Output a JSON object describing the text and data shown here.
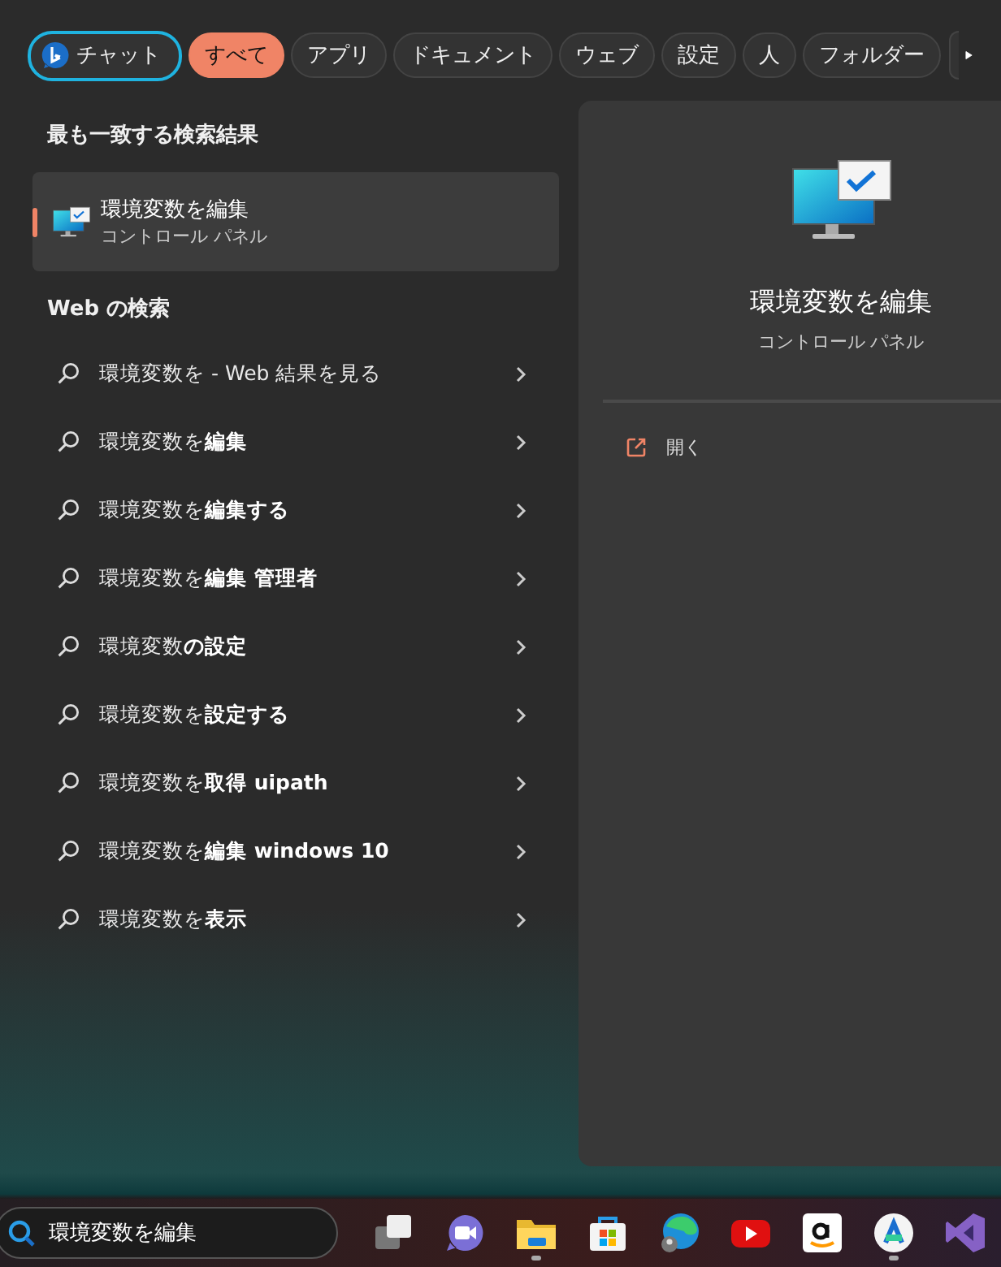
{
  "filters": [
    {
      "label": "チャット",
      "kind": "chat",
      "selected": false
    },
    {
      "label": "すべて",
      "kind": "plain",
      "selected": true
    },
    {
      "label": "アプリ",
      "kind": "plain",
      "selected": false
    },
    {
      "label": "ドキュメント",
      "kind": "plain",
      "selected": false
    },
    {
      "label": "ウェブ",
      "kind": "plain",
      "selected": false
    },
    {
      "label": "設定",
      "kind": "plain",
      "selected": false
    },
    {
      "label": "人",
      "kind": "plain",
      "selected": false
    },
    {
      "label": "フォルダー",
      "kind": "plain",
      "selected": false
    }
  ],
  "best_match": {
    "heading": "最も一致する検索結果",
    "title": "環境変数を編集",
    "subtitle": "コントロール パネル",
    "selected": true
  },
  "web": {
    "heading": "Web の検索",
    "suggestions": [
      {
        "text": "環境変数を - Web 結果を見る"
      },
      {
        "text": "環境変数を**編集**"
      },
      {
        "text": "環境変数を**編集する**"
      },
      {
        "text": "環境変数を**編集 管理者**"
      },
      {
        "text": "環境変数**の設定**"
      },
      {
        "text": "環境変数を**設定する**"
      },
      {
        "text": "環境変数を**取得 uipath**"
      },
      {
        "text": "環境変数を**編集 windows 10**"
      },
      {
        "text": "環境変数を**表示**"
      }
    ]
  },
  "preview": {
    "title": "環境変数を編集",
    "subtitle": "コントロール パネル",
    "actions": [
      {
        "label": "開く"
      }
    ]
  },
  "taskbar": {
    "search_value": "環境変数を編集",
    "apps": [
      {
        "running": false
      },
      {
        "running": false
      },
      {
        "running": true
      },
      {
        "running": false
      },
      {
        "running": false
      },
      {
        "running": false
      },
      {
        "running": false
      },
      {
        "running": true
      },
      {
        "running": false
      }
    ]
  }
}
